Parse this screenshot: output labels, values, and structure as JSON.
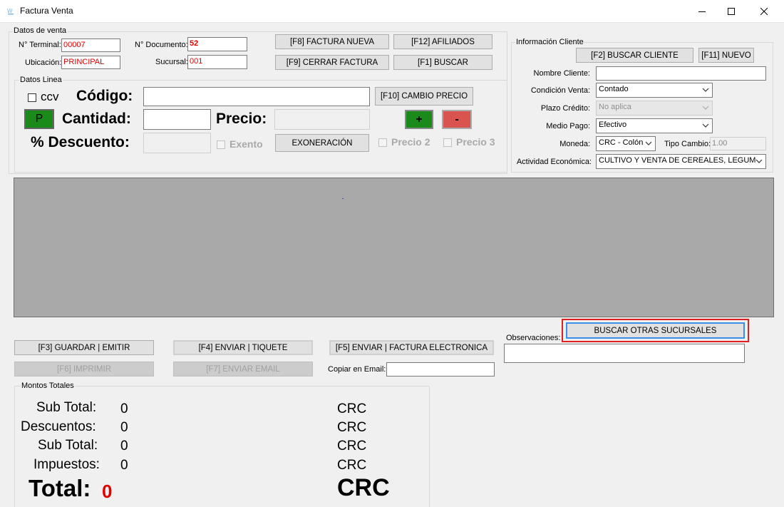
{
  "window": {
    "title": "Factura Venta"
  },
  "datos_venta": {
    "group_label": "Datos de venta",
    "terminal_label": "N° Terminal:",
    "terminal_value": "00007",
    "ubicacion_label": "Ubicación:",
    "ubicacion_value": "PRINCIPAL",
    "documento_label": "N° Documento:",
    "documento_value": "52",
    "sucursal_label": "Sucursal:",
    "sucursal_value": "001"
  },
  "toolbar": {
    "f8": "[F8] FACTURA NUEVA",
    "f12": "[F12] AFILIADOS",
    "f9": "[F9] CERRAR FACTURA",
    "f1": "[F1] BUSCAR"
  },
  "datos_linea": {
    "group_label": "Datos Linea",
    "ccv_label": "ccv",
    "codigo_label": "Código:",
    "codigo_value": "",
    "f10": "[F10] CAMBIO PRECIO",
    "p_button": "P",
    "cantidad_label": "Cantidad:",
    "cantidad_value": "",
    "precio_label": "Precio:",
    "precio_value": "",
    "plus": "+",
    "minus": "-",
    "descuento_label": "% Descuento:",
    "descuento_value": "",
    "exento_label": "Exento",
    "exoneracion": "EXONERACIÓN",
    "precio2_label": "Precio 2",
    "precio3_label": "Precio 3"
  },
  "cliente": {
    "group_label": "Información Cliente",
    "f2": "[F2] BUSCAR CLIENTE",
    "f11": "[F11] NUEVO",
    "nombre_label": "Nombre Cliente:",
    "nombre_value": "",
    "condicion_label": "Condición Venta:",
    "condicion_value": "Contado",
    "plazo_label": "Plazo Crédito:",
    "plazo_value": "No aplica",
    "medio_label": "Medio Pago:",
    "medio_value": "Efectivo",
    "moneda_label": "Moneda:",
    "moneda_value": "CRC - Colón",
    "tipo_cambio_label": "Tipo Cambio:",
    "tipo_cambio_value": "1.00",
    "actividad_label": "Actividad Económica:",
    "actividad_value": "CULTIVO Y VENTA DE CEREALES, LEGUM"
  },
  "actions": {
    "buscar_sucursales": "BUSCAR OTRAS SUCURSALES",
    "observaciones_label": "Observaciones:",
    "observaciones_value": "",
    "f3": "[F3] GUARDAR | EMITIR",
    "f4": "[F4] ENVIAR | TIQUETE",
    "f5": "[F5] ENVIAR | FACTURA ELECTRONICA",
    "f6": "[F6] IMPRIMIR",
    "f7": "[F7] ENVIAR EMAIL",
    "copiar_label": "Copiar en Email:",
    "copiar_value": ""
  },
  "totales": {
    "group_label": "Montos Totales",
    "subtotal1_label": "Sub Total:",
    "subtotal1_value": "0",
    "descuentos_label": "Descuentos:",
    "descuentos_value": "0",
    "subtotal2_label": "Sub Total:",
    "subtotal2_value": "0",
    "impuestos_label": "Impuestos:",
    "impuestos_value": "0",
    "total_label": "Total:",
    "total_value": "0",
    "currency": "CRC"
  },
  "colors": {
    "accent_red": "#e00000",
    "green_button": "#1a8a1a",
    "red_button": "#d9534f",
    "highlight_border": "#e02020",
    "grid_background": "#a9a9a9"
  }
}
